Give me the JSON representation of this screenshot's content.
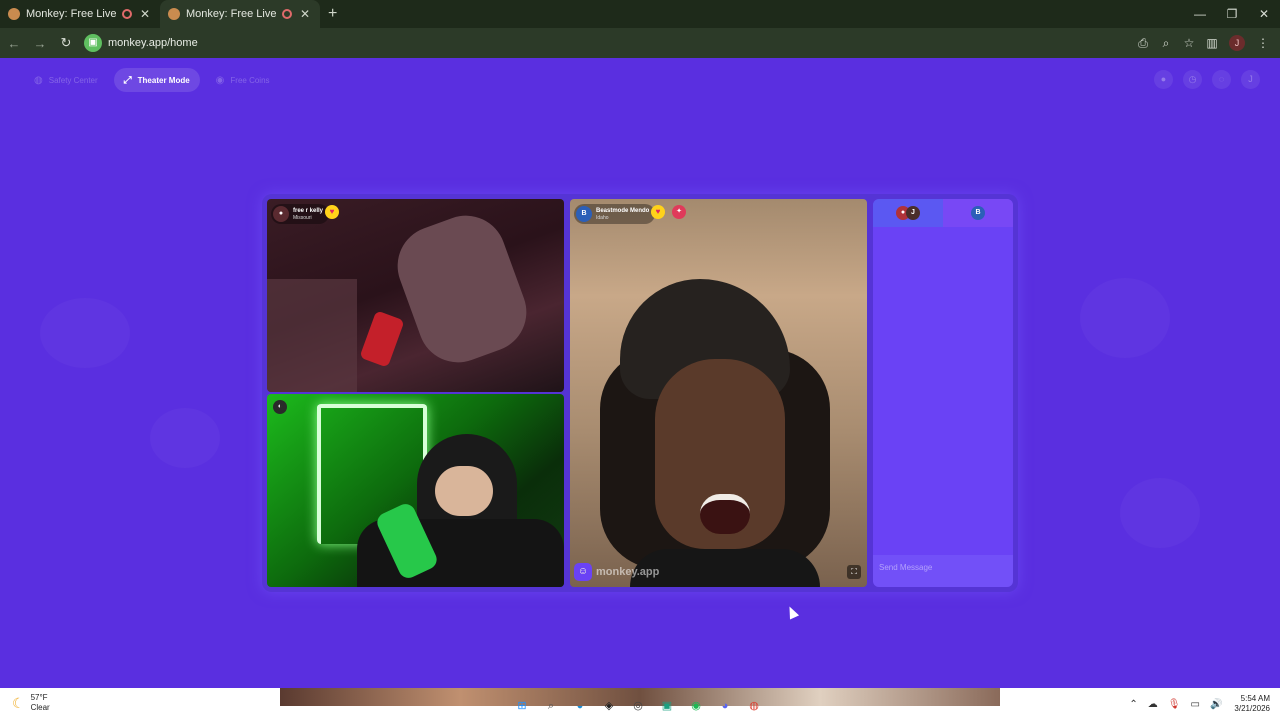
{
  "browser": {
    "tabs": [
      {
        "title": "Monkey: Free Live Video Ch",
        "close": "✕",
        "active": false
      },
      {
        "title": "Monkey: Free Live Video Ch",
        "close": "✕",
        "active": true
      }
    ],
    "new_tab": "+",
    "url": "monkey.app/home",
    "profile_initial": "J",
    "window_controls": {
      "minimize": "—",
      "maximize": "❐",
      "close": "✕"
    }
  },
  "nav": {
    "safety_center": "Safety Center",
    "theater_mode": "Theater Mode",
    "free_coins": "Free Coins",
    "user_initial": "J"
  },
  "video": {
    "user1": {
      "name": "free r kelly",
      "location": "Missouri"
    },
    "user2": {
      "initial": "B",
      "name": "Beastmode Mendo",
      "location": "Idaho"
    },
    "watermark": "monkey.app"
  },
  "chat": {
    "avatar_left": "J",
    "avatar_right": "B",
    "send_placeholder": "Send Message"
  },
  "taskbar": {
    "temperature": "57°F",
    "condition": "Clear",
    "time": "5:54 AM",
    "date": "3/21/2026"
  },
  "colors": {
    "page_bg": "#5a2fe0",
    "accent": "#6a42f5",
    "heart": "#ffd21a"
  }
}
